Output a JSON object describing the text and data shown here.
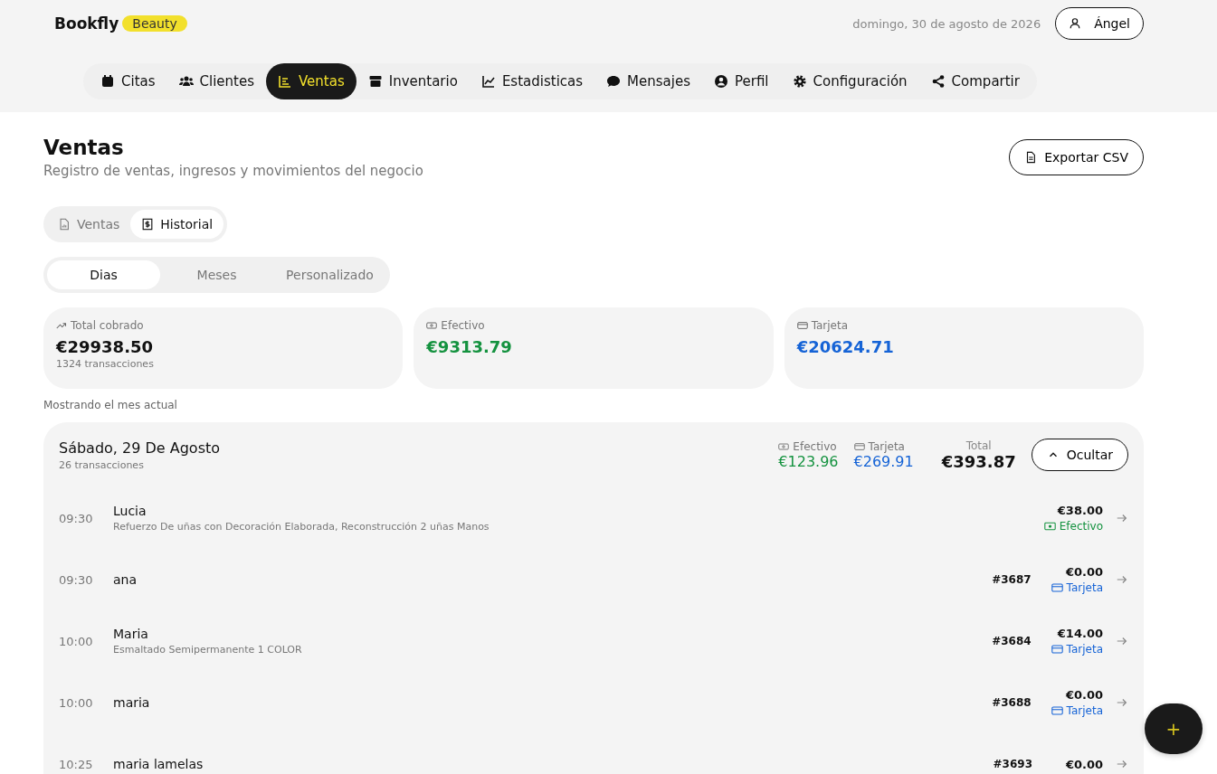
{
  "brand": {
    "name": "Bookfly",
    "badge": "Beauty"
  },
  "date": "domingo, 30 de agosto de 2026",
  "user": "Ángel",
  "nav": [
    {
      "label": "Citas",
      "kind": "calendar",
      "selected": false
    },
    {
      "label": "Clientes",
      "kind": "users",
      "selected": false
    },
    {
      "label": "Ventas",
      "kind": "list",
      "selected": true
    },
    {
      "label": "Inventario",
      "kind": "box",
      "selected": false
    },
    {
      "label": "Estadisticas",
      "kind": "chart",
      "selected": false
    },
    {
      "label": "Mensajes",
      "kind": "chat",
      "selected": false
    },
    {
      "label": "Perfil",
      "kind": "user",
      "selected": false
    },
    {
      "label": "Configuración",
      "kind": "gear",
      "selected": false
    },
    {
      "label": "Compartir",
      "kind": "share",
      "selected": false
    }
  ],
  "page": {
    "title": "Ventas",
    "subtitle": "Registro de ventas, ingresos y movimientos del negocio",
    "export": "Exportar CSV"
  },
  "view_tabs": [
    {
      "label": "Ventas",
      "kind": "doc",
      "selected": false
    },
    {
      "label": "Historial",
      "kind": "receipt",
      "selected": true
    }
  ],
  "period_tabs": [
    {
      "label": "Dias",
      "selected": true
    },
    {
      "label": "Meses",
      "selected": false
    },
    {
      "label": "Personalizado",
      "selected": false
    }
  ],
  "summary": [
    {
      "label": "Total cobrado",
      "kind": "total",
      "value": "€29938.50",
      "note": "1324 transacciones"
    },
    {
      "label": "Efectivo",
      "kind": "cash",
      "value": "€9313.79"
    },
    {
      "label": "Tarjeta",
      "kind": "card",
      "value": "€20624.71"
    }
  ],
  "showing": "Mostrando el mes actual",
  "day": {
    "title": "Sábado, 29 De Agosto",
    "count": "26 transacciones",
    "cash_label": "Efectivo",
    "cash": "€123.96",
    "card_label": "Tarjeta",
    "card": "€269.91",
    "total_label": "Total",
    "total": "€393.87",
    "toggle": "Ocultar",
    "expanded": true,
    "rows": [
      {
        "time": "09:30",
        "name": "Lucia",
        "detail": "Refuerzo De uñas con Decoración Elaborada, Reconstrucción 2 uñas Manos",
        "amount": "€38.00",
        "method": "Efectivo",
        "kind": "cash"
      },
      {
        "time": "09:30",
        "name": "ana",
        "ticket": "#3687",
        "amount": "€0.00",
        "method": "Tarjeta",
        "kind": "card"
      },
      {
        "time": "10:00",
        "name": "Maria",
        "detail": "Esmaltado Semipermanente 1 COLOR",
        "ticket": "#3684",
        "amount": "€14.00",
        "method": "Tarjeta",
        "kind": "card"
      },
      {
        "time": "10:00",
        "name": "maria",
        "ticket": "#3688",
        "amount": "€0.00",
        "method": "Tarjeta",
        "kind": "card"
      },
      {
        "time": "10:25",
        "name": "maria lamelas",
        "ticket": "#3693",
        "amount": "€0.00"
      }
    ]
  },
  "fab": "+"
}
